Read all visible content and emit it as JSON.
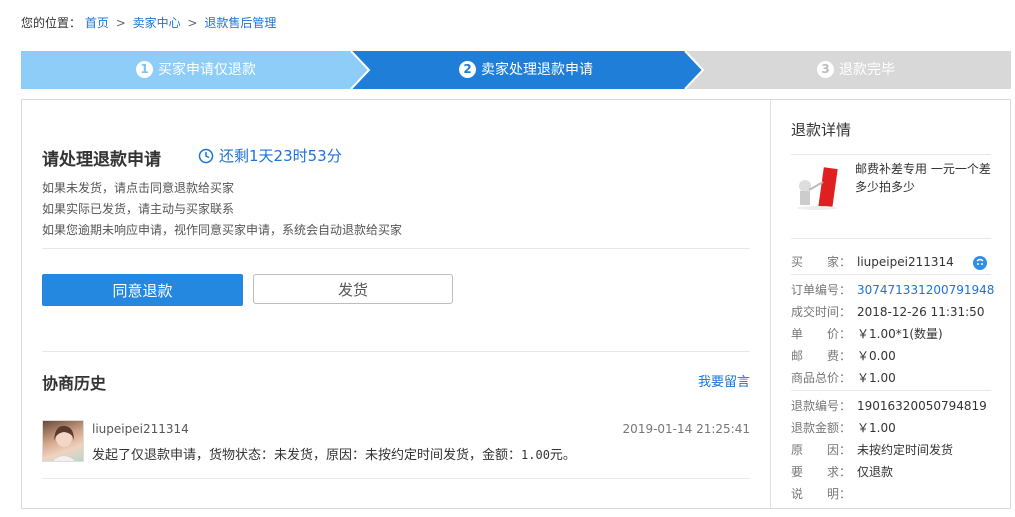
{
  "breadcrumb": {
    "label": "您的位置：",
    "items": [
      "首页",
      "卖家中心",
      "退款售后管理"
    ],
    "separator": ">"
  },
  "steps": [
    {
      "num": "1",
      "label": "买家申请仅退款",
      "state": "done",
      "color": "#8ecdf7"
    },
    {
      "num": "2",
      "label": "卖家处理退款申请",
      "state": "active",
      "color": "#1f7fd8"
    },
    {
      "num": "3",
      "label": "退款完毕",
      "state": "pending",
      "color": "#d8d8d8"
    }
  ],
  "main": {
    "title": "请处理退款申请",
    "timer": "还剩1天23时53分",
    "notices": [
      "如果未发货，请点击同意退款给买家",
      "如果实际已发货，请主动与买家联系",
      "如果您逾期未响应申请，视作同意买家申请，系统会自动退款给买家"
    ],
    "agree_button": "同意退款",
    "ship_button": "发货",
    "history": {
      "title": "协商历史",
      "leave_message": "我要留言",
      "entries": [
        {
          "user": "liupeipei211314",
          "time": "2019-01-14 21:25:41",
          "message_prefix": "发起了仅退款申请，货物状态：未发货，原因：未按约定时间发货，金额：",
          "amount": "1.00",
          "message_suffix": "元。"
        }
      ]
    }
  },
  "details": {
    "title": "退款详情",
    "product_name": "邮费补差专用 一元一个差多少拍多少",
    "thumb_text": "邮费补差专用",
    "buyer": {
      "label": "买　　家：",
      "value": "liupeipei211314"
    },
    "order": [
      {
        "label": "订单编号：",
        "value": "307471331200791948",
        "link": true
      },
      {
        "label": "成交时间：",
        "value": "2018-12-26 11:31:50"
      },
      {
        "label": "单　　价：",
        "value": "￥1.00*1(数量)"
      },
      {
        "label": "邮　　费：",
        "value": "￥0.00"
      },
      {
        "label": "商品总价：",
        "value": "￥1.00"
      }
    ],
    "refund": [
      {
        "label": "退款编号：",
        "value": "19016320050794819"
      },
      {
        "label": "退款金额：",
        "value": "￥1.00"
      },
      {
        "label": "原　　因：",
        "value": "未按约定时间发货"
      },
      {
        "label": "要　　求：",
        "value": "仅退款"
      },
      {
        "label": "说　　明：",
        "value": ""
      }
    ]
  },
  "colors": {
    "accent": "#1f7fd8",
    "link": "#1a73d8",
    "step_done": "#8ecdf7",
    "step_pending": "#d8d8d8"
  }
}
